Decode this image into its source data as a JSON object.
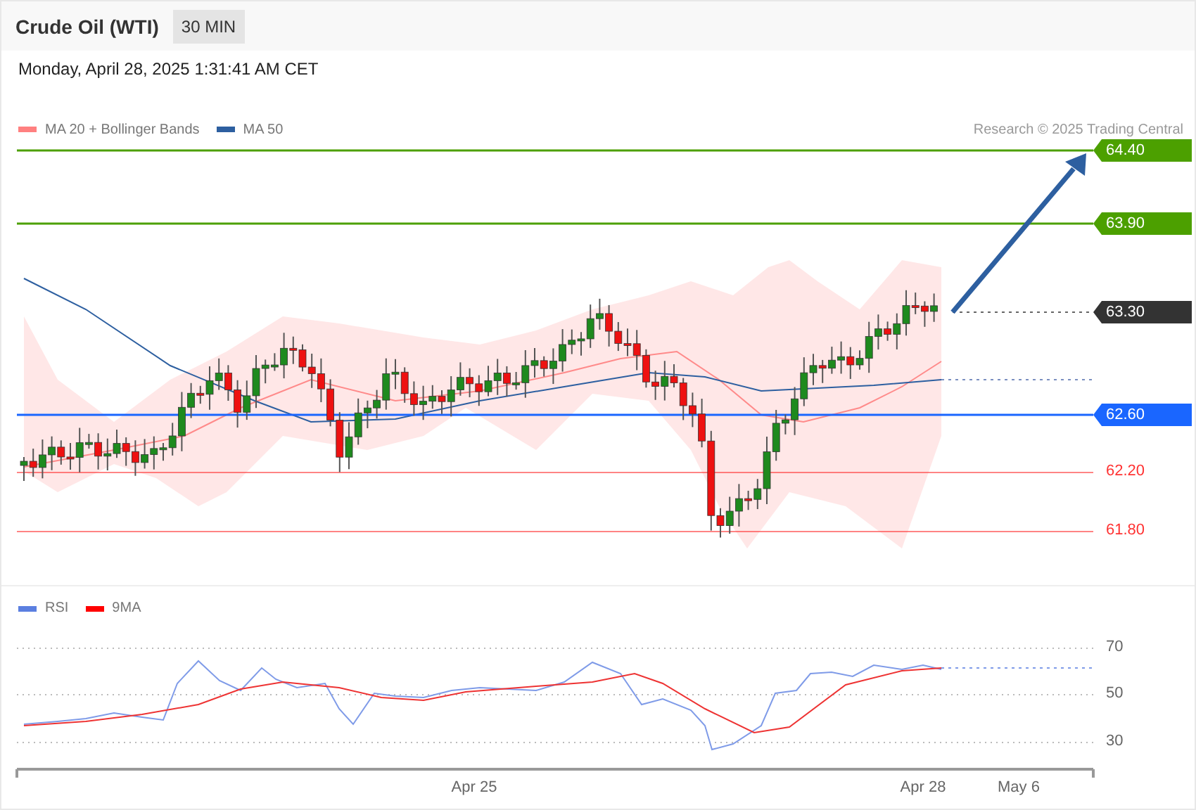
{
  "header": {
    "title": "Crude Oil (WTI)",
    "interval": "30 MIN"
  },
  "timestamp": "Monday, April 28, 2025 1:31:41 AM CET",
  "price_chart": {
    "legend": [
      {
        "label": "MA 20 + Bollinger Bands",
        "color": "#ff8080"
      },
      {
        "label": "MA 50",
        "color": "#2d5fa0"
      }
    ],
    "credit": "Research © 2025 Trading Central",
    "levels": [
      {
        "label": "64.40",
        "kind": "tag",
        "color": "#4ca000",
        "dashed": false
      },
      {
        "label": "63.90",
        "kind": "tag",
        "color": "#4ca000",
        "dashed": false
      },
      {
        "label": "63.30",
        "kind": "tag",
        "color": "#333333",
        "dashed": true
      },
      {
        "label": "62.60",
        "kind": "tag",
        "color": "#1a66ff",
        "dashed": false
      },
      {
        "label": "62.20",
        "kind": "plain",
        "color": "#ff3333",
        "dashed": false
      },
      {
        "label": "61.80",
        "kind": "plain",
        "color": "#ff3333",
        "dashed": false
      }
    ]
  },
  "rsi_chart": {
    "legend": [
      {
        "label": "RSI",
        "color": "#5b7fe0"
      },
      {
        "label": "9MA",
        "color": "#ff0000"
      }
    ],
    "ticks": [
      "70",
      "50",
      "30"
    ],
    "dates": [
      "Apr 25",
      "Apr 28",
      "May 6"
    ]
  }
}
